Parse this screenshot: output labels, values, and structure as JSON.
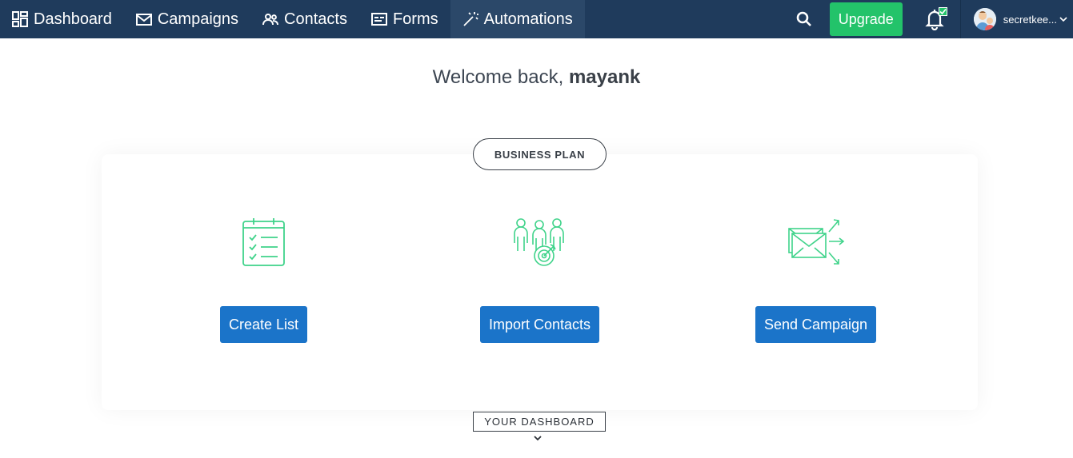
{
  "nav": {
    "items": [
      {
        "label": "Dashboard",
        "icon": "dashboard-grid-icon"
      },
      {
        "label": "Campaigns",
        "icon": "envelope-icon"
      },
      {
        "label": "Contacts",
        "icon": "people-icon"
      },
      {
        "label": "Forms",
        "icon": "form-icon"
      },
      {
        "label": "Automations",
        "icon": "magic-wand-icon"
      }
    ],
    "active": "Automations"
  },
  "header": {
    "upgrade_label": "Upgrade",
    "username": "secretkee...",
    "notification_badge": "check"
  },
  "welcome": {
    "prefix": "Welcome back,",
    "name": "mayank"
  },
  "plan": {
    "label": "BUSINESS PLAN"
  },
  "actions": [
    {
      "label": "Create List",
      "icon": "checklist-clipboard-icon"
    },
    {
      "label": "Import Contacts",
      "icon": "target-audience-icon"
    },
    {
      "label": "Send Campaign",
      "icon": "send-envelopes-icon"
    }
  ],
  "dashboard_toggle": {
    "label": "YOUR DASHBOARD"
  },
  "colors": {
    "topbar": "#1f3b5c",
    "active_tab": "#2b4869",
    "upgrade": "#23c36a",
    "primary_button": "#1b74c9",
    "icon_green": "#3fd38a"
  }
}
